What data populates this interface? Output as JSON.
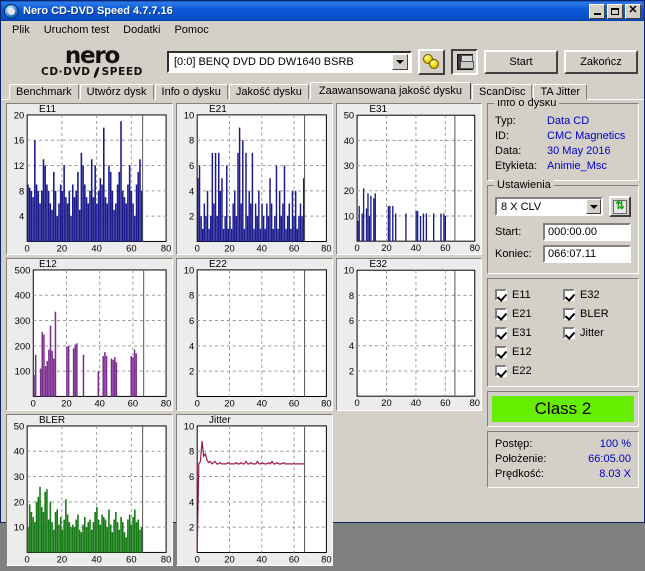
{
  "window": {
    "title": "Nero CD-DVD Speed 4.7.7.16",
    "icon": "nero-disc-icon",
    "minimize_label": "_",
    "maximize_label": "□",
    "close_label": "×"
  },
  "menu": {
    "items": [
      {
        "label": "Plik"
      },
      {
        "label": "Uruchom test"
      },
      {
        "label": "Dodatki"
      },
      {
        "label": "Pomoc"
      }
    ]
  },
  "toolbar": {
    "logo_word": "nero",
    "logo_sub_left": "CD·DVD",
    "logo_sub_right": "SPEED",
    "drive_value": "[0:0]   BENQ DVD DD DW1640 BSRB",
    "eject_icon": "disc-eject-icon",
    "save_icon": "floppy-save-icon",
    "start_label": "Start",
    "exit_label": "Zakończ"
  },
  "tabs": [
    {
      "label": "Benchmark",
      "active": false
    },
    {
      "label": "Utwórz dysk",
      "active": false
    },
    {
      "label": "Info o dysku",
      "active": false
    },
    {
      "label": "Jakość dysku",
      "active": false
    },
    {
      "label": "Zaawansowana jakość dysku",
      "active": true
    },
    {
      "label": "ScanDisc",
      "active": false
    },
    {
      "label": "TA Jitter",
      "active": false
    }
  ],
  "sidebar": {
    "disc_info": {
      "legend": "Info o dysku",
      "rows": [
        {
          "key": "Typ:",
          "value": "Data CD"
        },
        {
          "key": "ID:",
          "value": "CMC Magnetics"
        },
        {
          "key": "Data:",
          "value": "30 May 2016"
        },
        {
          "key": "Etykieta:",
          "value": "Animie_Msc"
        }
      ]
    },
    "settings": {
      "legend": "Ustawienia",
      "speed_value": "8 X CLV",
      "refresh_icon": "refresh-arrows-icon",
      "start_label": "Start:",
      "start_value": "000:00.00",
      "end_label": "Koniec:",
      "end_value": "066:07.11"
    },
    "checkboxes": {
      "left": [
        {
          "label": "E11",
          "checked": true
        },
        {
          "label": "E21",
          "checked": true
        },
        {
          "label": "E31",
          "checked": true
        },
        {
          "label": "E12",
          "checked": true
        },
        {
          "label": "E22",
          "checked": true
        }
      ],
      "right": [
        {
          "label": "E32",
          "checked": true
        },
        {
          "label": "BLER",
          "checked": true
        },
        {
          "label": "Jitter",
          "checked": true
        }
      ]
    },
    "class_badge": {
      "label": "Class 2",
      "color": "#66ee00"
    },
    "status": {
      "rows": [
        {
          "key": "Postęp:",
          "value": "100 %"
        },
        {
          "key": "Położenie:",
          "value": "66:05.00"
        },
        {
          "key": "Prędkość:",
          "value": "8.03 X"
        }
      ]
    }
  },
  "chart_data": [
    {
      "id": "e11",
      "type": "bar",
      "title": "E11",
      "color": "#1a1a8c",
      "xlabel": "",
      "ylabel": "",
      "xlim": [
        0,
        80
      ],
      "ylim": [
        0,
        20
      ],
      "xticks": [
        0,
        20,
        40,
        60,
        80
      ],
      "yticks": [
        4,
        8,
        12,
        16,
        20
      ],
      "grid": true,
      "scan_end_marker": 66.5,
      "values": [
        9,
        8.5,
        8,
        7,
        16,
        9,
        8,
        6,
        8,
        13,
        12,
        9,
        8,
        6,
        5,
        11,
        8,
        4,
        6,
        9,
        8,
        12,
        7,
        6,
        8,
        4,
        9,
        7,
        8,
        11,
        5,
        14,
        12,
        9,
        7,
        6,
        8,
        13,
        7,
        12,
        6,
        8,
        10,
        9,
        18,
        7,
        6,
        12,
        11,
        8,
        5,
        6,
        9,
        11,
        19,
        8,
        7,
        6,
        9,
        12,
        8,
        6,
        4,
        9,
        11,
        13,
        8
      ]
    },
    {
      "id": "e21",
      "type": "bar",
      "title": "E21",
      "color": "#1a1a8c",
      "xlim": [
        0,
        80
      ],
      "ylim": [
        0,
        10
      ],
      "xticks": [
        0,
        20,
        40,
        60,
        80
      ],
      "yticks": [
        2,
        4,
        6,
        8,
        10
      ],
      "grid": true,
      "scan_end_marker": 66.5,
      "values": [
        5,
        6,
        2,
        1,
        3,
        2,
        4,
        1,
        2,
        7,
        3,
        7,
        2,
        7,
        4,
        5,
        1,
        2,
        6,
        1,
        2,
        1,
        3,
        4,
        2,
        7,
        9,
        3,
        8,
        1,
        7,
        2,
        4,
        3,
        7,
        1,
        3,
        2,
        4,
        1,
        3,
        2,
        1,
        3,
        2,
        5,
        3,
        1,
        2,
        6,
        1,
        4,
        2,
        3,
        6,
        1,
        2,
        3,
        1,
        4,
        2,
        4,
        1,
        2,
        3,
        2,
        5
      ]
    },
    {
      "id": "e31",
      "type": "bar",
      "title": "E31",
      "color": "#1a1a8c",
      "xlim": [
        0,
        80
      ],
      "ylim": [
        0,
        50
      ],
      "xticks": [
        0,
        20,
        40,
        60,
        80
      ],
      "yticks": [
        10,
        20,
        30,
        40,
        50
      ],
      "grid": true,
      "scan_end_marker": 66.5,
      "values": [
        8,
        14,
        0,
        11,
        21,
        0,
        13,
        19,
        10,
        18,
        0,
        17,
        19,
        0,
        0,
        0,
        0,
        0,
        0,
        0,
        0,
        14,
        14,
        0,
        14,
        0,
        11,
        0,
        0,
        0,
        0,
        0,
        0,
        11,
        0,
        0,
        0,
        0,
        0,
        0,
        12,
        12,
        0,
        10,
        0,
        11,
        0,
        11,
        0,
        0,
        0,
        0,
        11,
        0,
        0,
        0,
        0,
        11,
        0,
        11,
        10,
        0,
        0,
        0,
        0,
        0,
        0
      ]
    },
    {
      "id": "e12",
      "type": "bar",
      "title": "E12",
      "color": "#7b2d8e",
      "xlim": [
        0,
        80
      ],
      "ylim": [
        0,
        500
      ],
      "xticks": [
        0,
        20,
        40,
        60,
        80
      ],
      "yticks": [
        100,
        200,
        300,
        400,
        500
      ],
      "grid": true,
      "scan_end_marker": 66.5,
      "values": [
        85,
        165,
        0,
        0,
        110,
        255,
        245,
        120,
        140,
        185,
        280,
        180,
        150,
        335,
        0,
        0,
        0,
        0,
        0,
        0,
        198,
        200,
        0,
        0,
        190,
        205,
        210,
        0,
        0,
        0,
        165,
        0,
        0,
        0,
        0,
        0,
        0,
        0,
        0,
        100,
        0,
        0,
        160,
        175,
        160,
        0,
        0,
        150,
        145,
        155,
        135,
        0,
        0,
        0,
        0,
        0,
        0,
        0,
        0,
        160,
        155,
        185,
        170,
        0,
        0,
        0,
        0
      ]
    },
    {
      "id": "e22",
      "type": "bar",
      "title": "E22",
      "color": "#1a1a8c",
      "xlim": [
        0,
        80
      ],
      "ylim": [
        0,
        10
      ],
      "xticks": [
        0,
        20,
        40,
        60,
        80
      ],
      "yticks": [
        2,
        4,
        6,
        8,
        10
      ],
      "grid": true,
      "scan_end_marker": 66.5,
      "values": []
    },
    {
      "id": "e32",
      "type": "bar",
      "title": "E32",
      "color": "#1a1a8c",
      "xlim": [
        0,
        80
      ],
      "ylim": [
        0,
        10
      ],
      "xticks": [
        0,
        20,
        40,
        60,
        80
      ],
      "yticks": [
        2,
        4,
        6,
        8,
        10
      ],
      "grid": true,
      "scan_end_marker": 66.5,
      "values": []
    },
    {
      "id": "bler",
      "type": "bar",
      "title": "BLER",
      "color": "#147a14",
      "xlim": [
        0,
        80
      ],
      "ylim": [
        0,
        50
      ],
      "xticks": [
        0,
        20,
        40,
        60,
        80
      ],
      "yticks": [
        10,
        20,
        30,
        40,
        50
      ],
      "grid": true,
      "scan_end_marker": 66.5,
      "values": [
        10,
        19,
        16,
        14,
        12,
        20,
        22,
        26,
        18,
        16,
        24,
        25,
        13,
        20,
        12,
        9,
        16,
        17,
        11,
        14,
        9,
        13,
        21,
        15,
        12,
        10,
        11,
        10,
        13,
        15,
        9,
        8,
        11,
        14,
        10,
        12,
        13,
        9,
        12,
        16,
        18,
        13,
        11,
        15,
        14,
        13,
        10,
        17,
        11,
        8,
        13,
        16,
        12,
        9,
        14,
        12,
        8,
        6,
        13,
        15,
        11,
        14,
        17,
        12,
        13,
        9,
        10
      ]
    },
    {
      "id": "jitter",
      "type": "line",
      "title": "Jitter",
      "color": "#9b1a4a",
      "xlim": [
        0,
        80
      ],
      "ylim": [
        0,
        10
      ],
      "xticks": [
        0,
        20,
        40,
        60,
        80
      ],
      "yticks": [
        2,
        4,
        6,
        8,
        10
      ],
      "grid": true,
      "scan_end_marker": 66.5,
      "values": [
        0,
        7,
        7.2,
        8.8,
        7.6,
        7.8,
        7.3,
        7.1,
        7.2,
        7.0,
        7.1,
        7.2,
        7.0,
        7.0,
        7.1,
        7.0,
        7.0,
        7.0,
        7.0,
        7.1,
        7.0,
        7.0,
        7.0,
        7.0,
        7.1,
        7.0,
        7.0,
        7.1,
        7.0,
        7.0,
        7.2,
        7.0,
        7.0,
        7.1,
        7.0,
        7.0,
        7.0,
        7.2,
        7.0,
        7.0,
        7.1,
        7.0,
        7.0,
        7.0,
        7.1,
        7.0,
        7.2,
        7.0,
        7.0,
        7.1,
        7.0,
        7.0,
        7.0,
        7.1,
        7.0,
        7.0,
        7.0,
        7.0,
        7.0,
        7.0,
        7.0,
        7.0,
        7.0,
        7.0,
        7.0,
        7.0,
        7.0
      ]
    }
  ]
}
